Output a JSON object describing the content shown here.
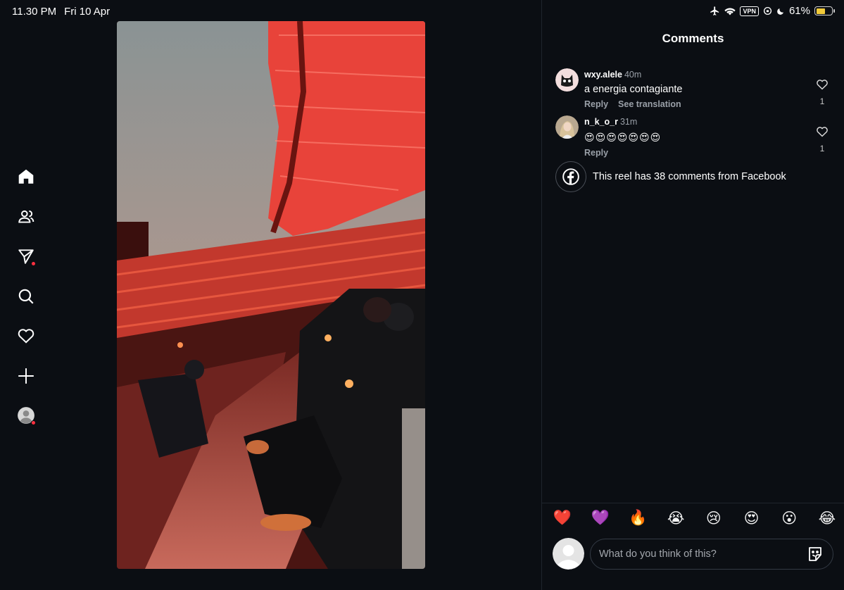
{
  "status_bar": {
    "time": "11.30 PM",
    "date": "Fri 10 Apr",
    "vpn": "VPN",
    "battery": "61%",
    "battery_level": 0.61,
    "icons": [
      "airplane-icon",
      "wifi-icon",
      "vpn-badge",
      "orientation-lock-icon",
      "moon-icon",
      "battery-icon"
    ]
  },
  "nav": {
    "items": [
      {
        "name": "home",
        "icon": "home-icon"
      },
      {
        "name": "people",
        "icon": "people-icon"
      },
      {
        "name": "messages",
        "icon": "send-icon",
        "dot": true
      },
      {
        "name": "search",
        "icon": "search-icon"
      },
      {
        "name": "activity",
        "icon": "heart-icon"
      },
      {
        "name": "create",
        "icon": "plus-icon"
      },
      {
        "name": "profile",
        "icon": "profile-icon",
        "dot": true
      }
    ],
    "dot_color": "#ff3040"
  },
  "panel": {
    "title": "Comments"
  },
  "comments": [
    {
      "username": "wxy.alele",
      "time": "40m",
      "text": "a energia contagiante",
      "reply": "Reply",
      "translate": "See translation",
      "likes": "1"
    },
    {
      "username": "n_k_o_r",
      "time": "31m",
      "text": "😍😍😍😍😍😍😍",
      "reply": "Reply",
      "likes": "1"
    }
  ],
  "facebook_note": "This reel has 38 comments from Facebook",
  "reactions": [
    "❤️",
    "💜",
    "🔥",
    "😭",
    "😢",
    "😍",
    "😮",
    "😂"
  ],
  "input": {
    "placeholder": "What do you think of this?"
  },
  "colors": {
    "background": "#0b0e13",
    "accent_red": "#ff3040",
    "muted_text": "#9aa0a8"
  }
}
